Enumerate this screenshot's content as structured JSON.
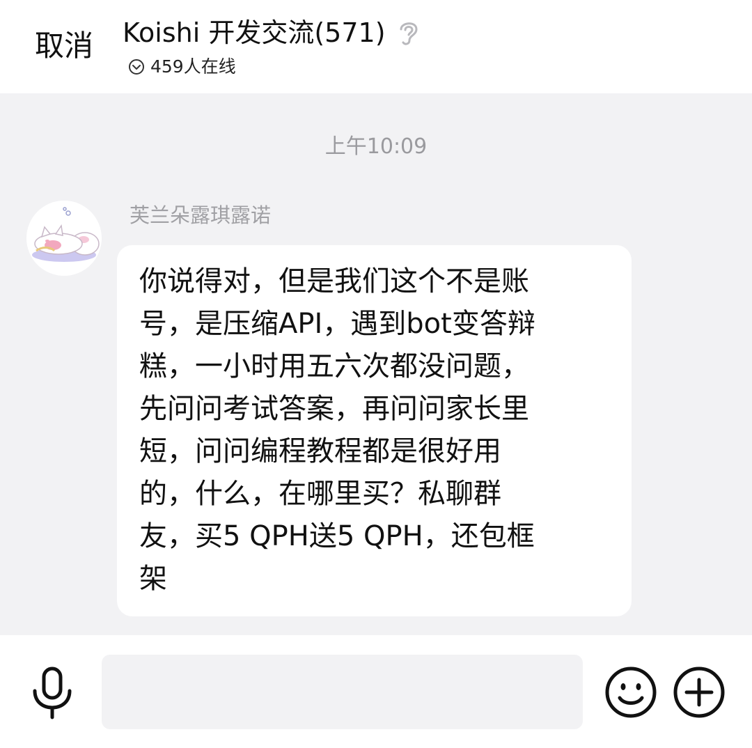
{
  "header": {
    "cancel_label": "取消",
    "title": "Koishi 开发交流(571)",
    "online_text": "459人在线"
  },
  "chat": {
    "timestamp": "上午10:09",
    "messages": [
      {
        "sender": "芙兰朵露琪露诺",
        "text": "你说得对，但是我们这个不是账\n号，是压缩API，遇到bot变答辩\n糕，一小时用五六次都没问题，\n先问问考试答案，再问问家长里\n短，问问编程教程都是很好用\n的，什么，在哪里买？私聊群\n友，买5 QPH送5 QPH，还包框\n架"
      }
    ]
  },
  "input_bar": {
    "value": "",
    "placeholder": ""
  },
  "icons": {
    "voice": "mic-icon",
    "emoji": "emoji-icon",
    "more": "plus-icon",
    "hearing": "ear-icon",
    "expand": "chevron-down-icon"
  }
}
